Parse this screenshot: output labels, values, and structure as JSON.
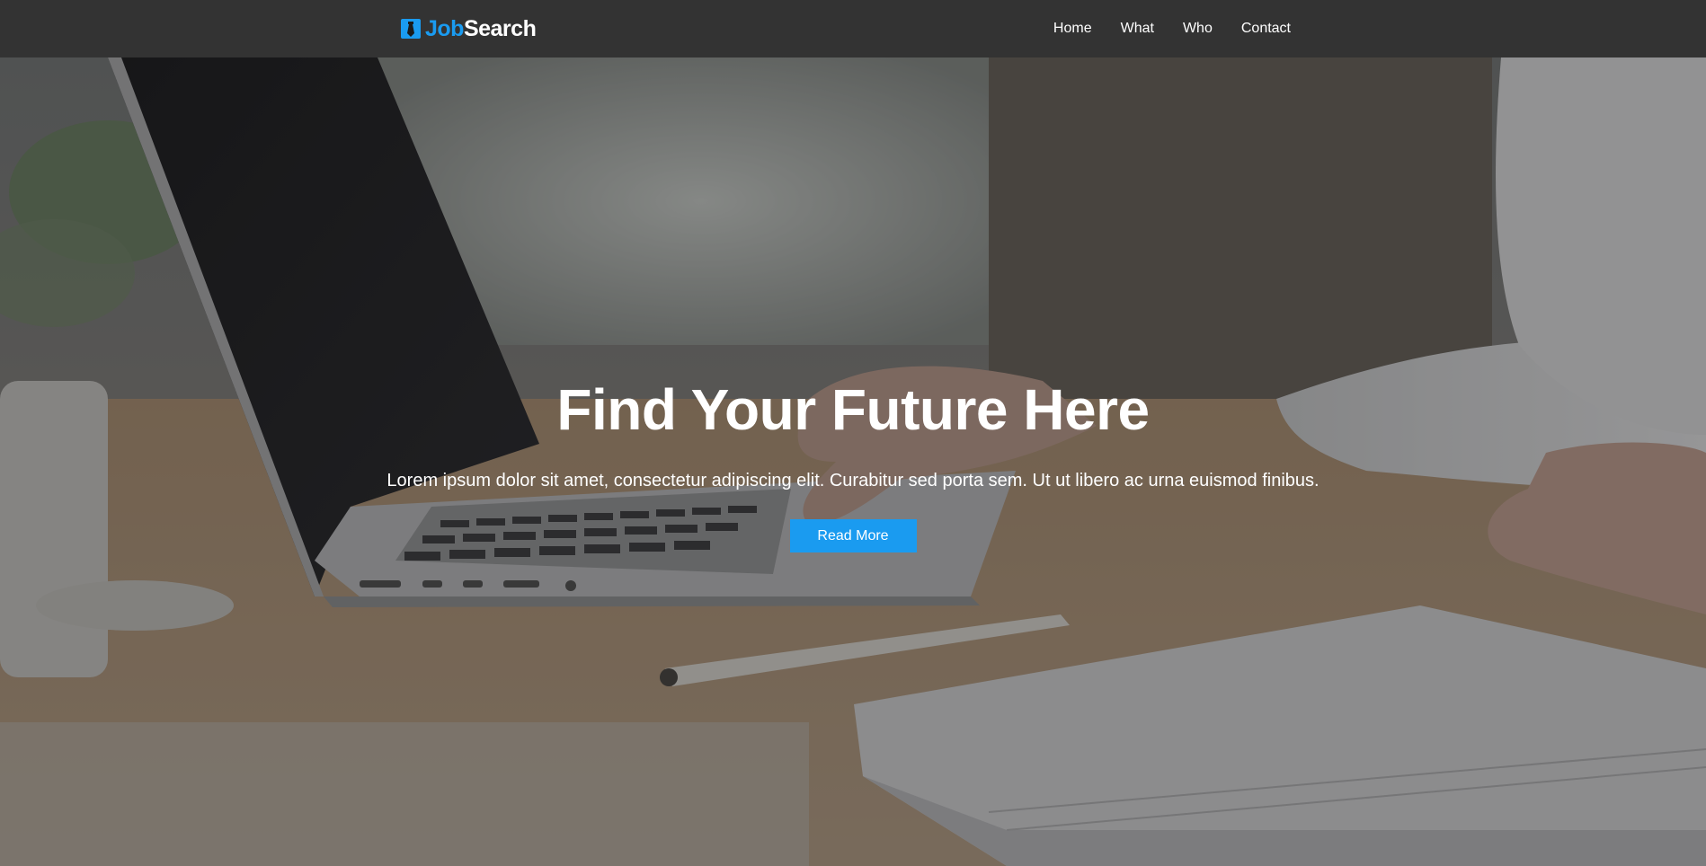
{
  "nav": {
    "brand": {
      "part1": "Job",
      "part2": "Search",
      "icon": "tie-icon"
    },
    "links": [
      "Home",
      "What",
      "Who",
      "Contact"
    ]
  },
  "hero": {
    "title": "Find Your Future Here",
    "subtitle": "Lorem ipsum dolor sit amet, consectetur adipiscing elit. Curabitur sed porta sem. Ut ut libero ac urna euismod finibus.",
    "cta_label": "Read More"
  },
  "colors": {
    "accent": "#1a9bf0",
    "navbar": "#333333",
    "text": "#ffffff"
  }
}
